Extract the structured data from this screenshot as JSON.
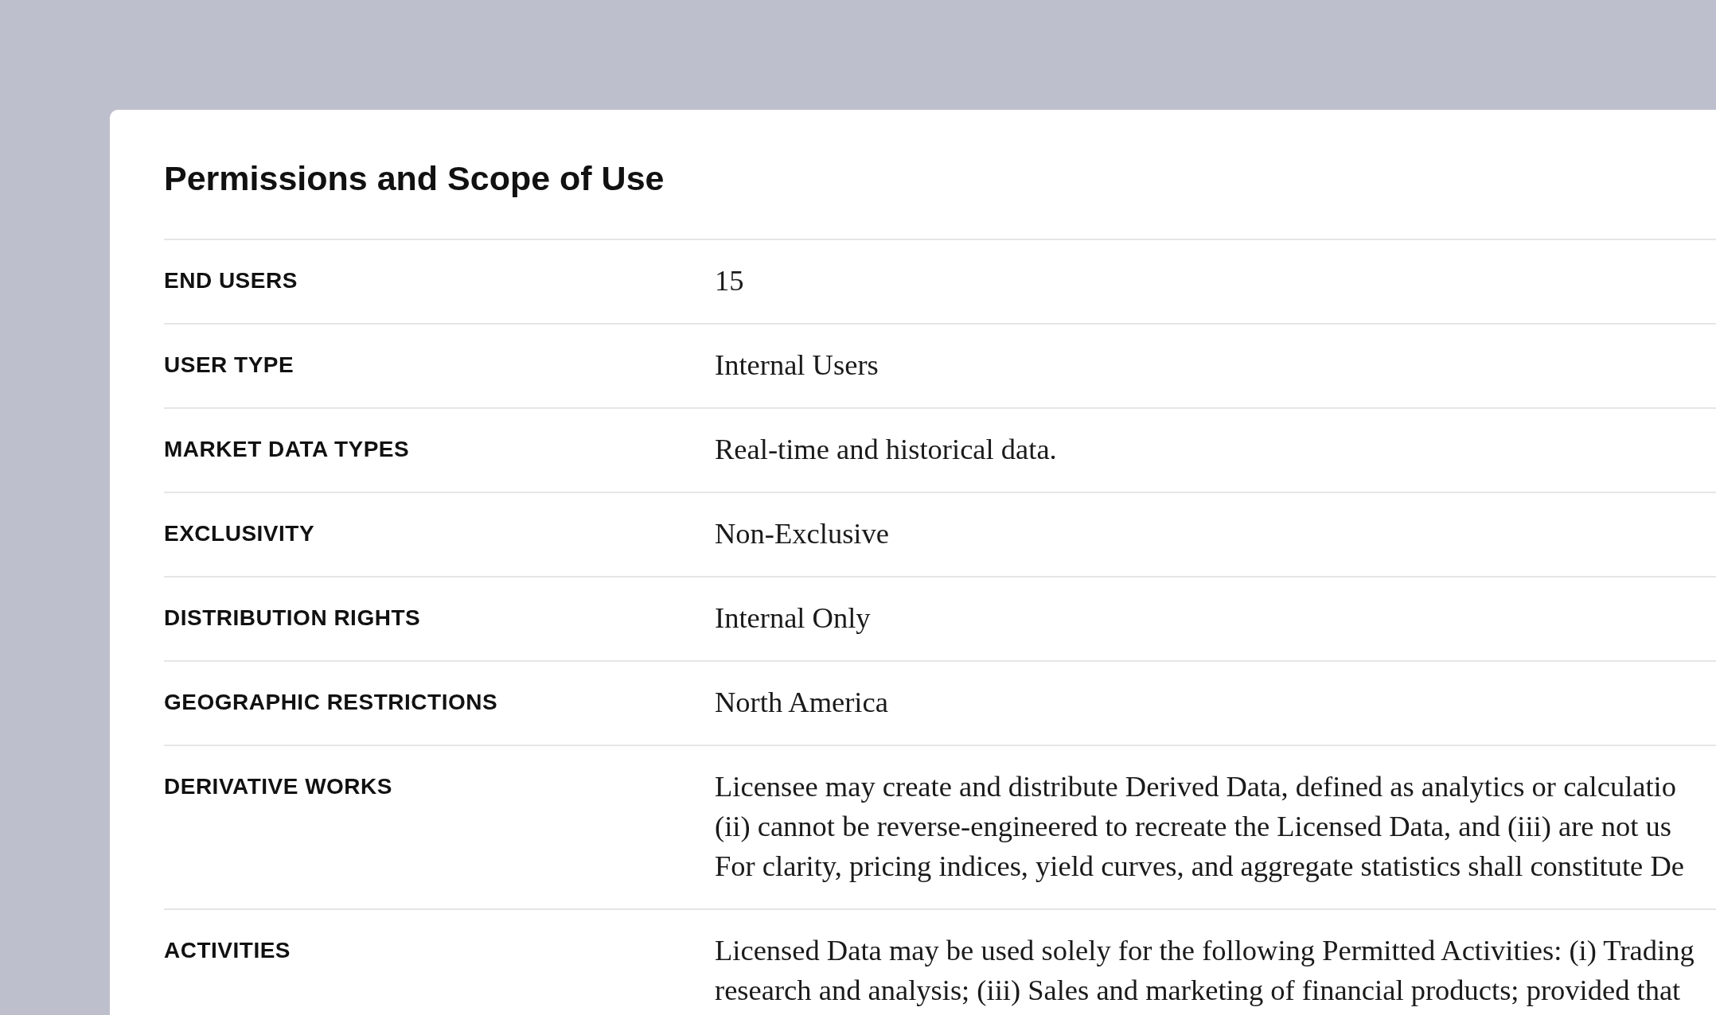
{
  "card": {
    "title": "Permissions and Scope of Use",
    "rows": [
      {
        "label": "END USERS",
        "value_lines": [
          "15"
        ]
      },
      {
        "label": "USER TYPE",
        "value_lines": [
          "Internal Users"
        ]
      },
      {
        "label": "MARKET DATA TYPES",
        "value_lines": [
          "Real-time and historical data."
        ]
      },
      {
        "label": "EXCLUSIVITY",
        "value_lines": [
          "Non-Exclusive"
        ]
      },
      {
        "label": "DISTRIBUTION RIGHTS",
        "value_lines": [
          "Internal Only"
        ]
      },
      {
        "label": "GEOGRAPHIC RESTRICTIONS",
        "value_lines": [
          "North America"
        ]
      },
      {
        "label": "DERIVATIVE WORKS",
        "value_lines": [
          "Licensee may create and distribute Derived Data, defined as analytics or calculatio",
          "(ii) cannot be reverse-engineered to recreate the Licensed Data, and (iii) are not us",
          "For clarity, pricing indices, yield curves, and aggregate statistics shall constitute De"
        ]
      },
      {
        "label": "ACTIVITIES",
        "value_lines": [
          "Licensed Data may be used solely for the following Permitted Activities: (i) Trading",
          "research and analysis; (iii) Sales and marketing of financial products; provided that"
        ]
      }
    ]
  }
}
